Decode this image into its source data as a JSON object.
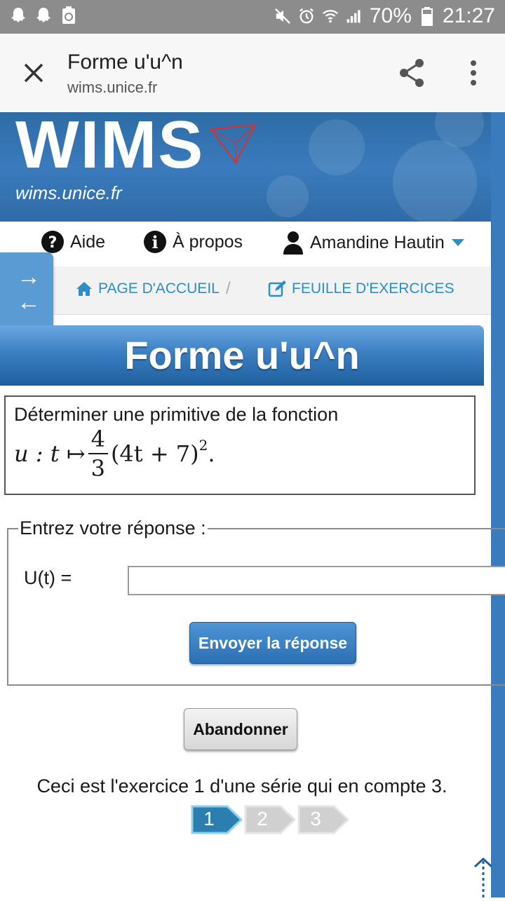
{
  "status_bar": {
    "battery": "70%",
    "time": "21:27"
  },
  "browser": {
    "title": "Forme u'u^n",
    "url": "wims.unice.fr"
  },
  "banner": {
    "logo": "WIMS",
    "subtitle": "wims.unice.fr"
  },
  "menu": {
    "help": "Aide",
    "about": "À propos",
    "user": "Amandine Hautin"
  },
  "breadcrumb": {
    "home": "PAGE D'ACCUEIL",
    "separator": "/",
    "sheet": "FEUILLE D'EXERCICES"
  },
  "exercise": {
    "title": "Forme u'u^n",
    "statement": "Déterminer une primitive de la fonction",
    "formula": {
      "lhs": "u : t ↦",
      "numerator": "4",
      "denominator": "3",
      "body": "(4t + 7)",
      "exponent": "2",
      "trail": "."
    }
  },
  "answer": {
    "legend": "Entrez votre réponse :",
    "label": "U(t) =",
    "value": "",
    "submit": "Envoyer la réponse"
  },
  "abandon": "Abandonner",
  "series": {
    "text": "Ceci est l'exercice 1 d'une série qui en compte 3.",
    "steps": [
      "1",
      "2",
      "3"
    ],
    "current": 1
  },
  "colors": {
    "accent": "#3a7bbd",
    "link": "#2a8fc8",
    "step_active": "#2a7fb0",
    "step_inactive": "#d0d0d0"
  }
}
